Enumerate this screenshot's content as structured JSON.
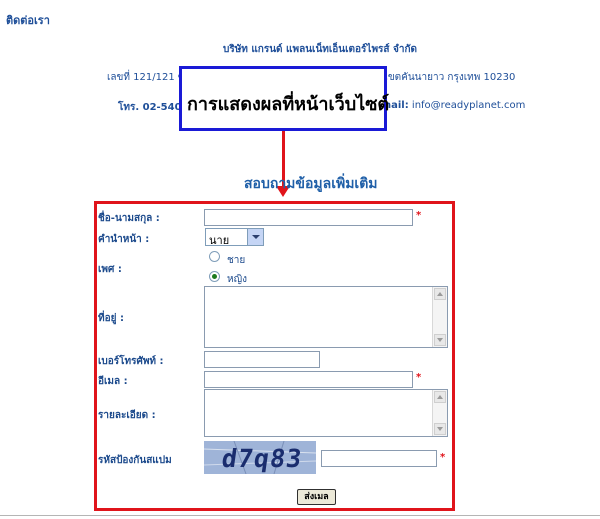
{
  "page": {
    "title": "ติดต่อเรา",
    "company_name": "บริษัท แกรนด์ แพลนเน็ทเอ็นเตอร์ไพรส์ จำกัด",
    "address_left": "เลขที่ 121/121 ซ",
    "address_right": "าว เขตคันนายาว กรุงเทพ 10230",
    "phone_left": "โทร. 02-540-",
    "email_label": "nail:",
    "email_value": "info@readyplanet.com"
  },
  "callout": {
    "text": "การแสดงผลที่หน้าเว็บไซต์"
  },
  "form": {
    "heading": "สอบถามข้อมูลเพิ่มเติม",
    "name_label": "ชื่อ-นามสกุล :",
    "title_label": "คำนำหน้า :",
    "title_value": "นาย",
    "gender_label": "เพศ :",
    "gender_male": "ชาย",
    "gender_female": "หญิง",
    "address_label": "ที่อยู่ :",
    "phone_label": "เบอร์โทรศัพท์ :",
    "email_label": "อีเมล :",
    "details_label": "รายละเอียด :",
    "captcha_label": "รหัสป้องกันสแปม",
    "captcha_text": "d7q83",
    "required_mark": "*",
    "submit_label": "ส่งเมล",
    "gender_selected": "female"
  },
  "colors": {
    "accent_red": "#e0141b",
    "callout_blue": "#1a1ad6",
    "text_blue": "#1c4a8c"
  }
}
